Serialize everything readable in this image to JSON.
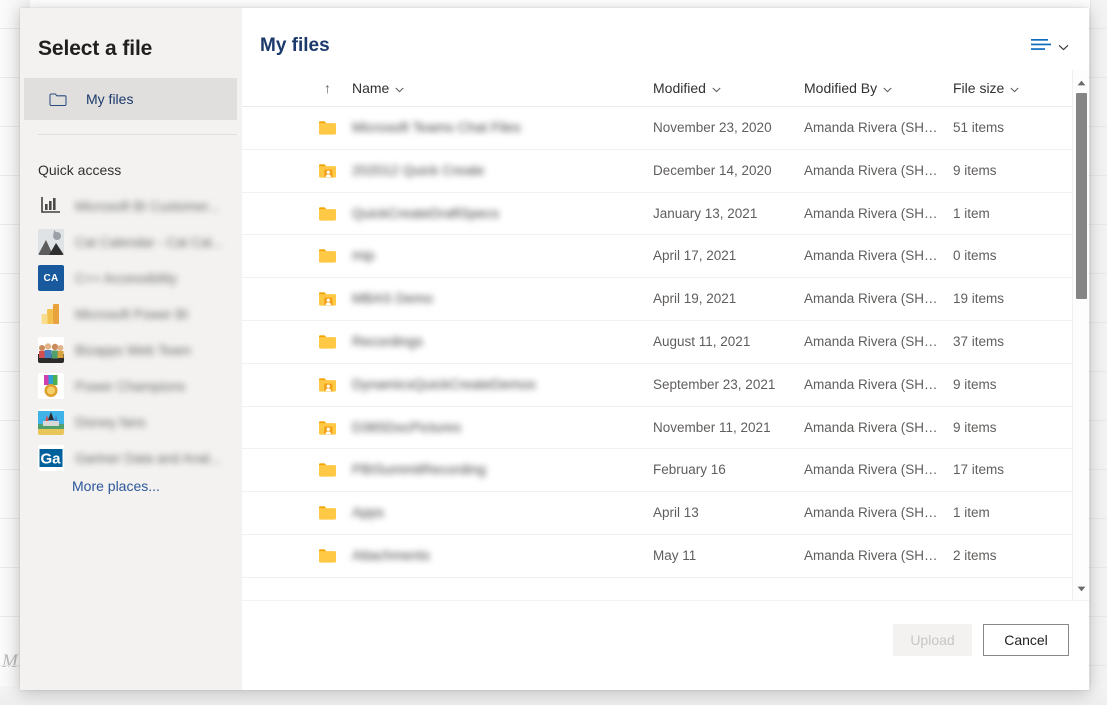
{
  "dialog": {
    "nav_title": "Select a file",
    "my_files_label": "My files",
    "my_files_icon": "folder-outline-icon",
    "quick_access_label": "Quick access",
    "more_places_label": "More places...",
    "quick_access_items": [
      {
        "label": "Microsoft BI Customer...",
        "icon": "power-bi-report-icon"
      },
      {
        "label": "Cat Calendar - Cat Cal...",
        "icon": "cat-photo-icon"
      },
      {
        "label": "C++ Accessibility",
        "icon": "ca-initials-icon",
        "initials": "CA",
        "color": "#185a9d"
      },
      {
        "label": "Microsoft Power BI",
        "icon": "power-bi-icon"
      },
      {
        "label": "Bizapps Web Team",
        "icon": "team-people-icon"
      },
      {
        "label": "Power Champions",
        "icon": "medal-icon"
      },
      {
        "label": "Disney fans",
        "icon": "castle-photo-icon"
      },
      {
        "label": "Gartner Data and Anal...",
        "icon": "gartner-logo-icon"
      }
    ]
  },
  "panel": {
    "title": "My files",
    "view_switcher_icon": "list-view-icon",
    "view_switcher_chevron": "chevron-down-icon"
  },
  "table": {
    "sort_indicator": "↑",
    "columns": [
      {
        "key": "name",
        "label": "Name",
        "chevron": "chevron-down-icon"
      },
      {
        "key": "modified",
        "label": "Modified",
        "chevron": "chevron-down-icon"
      },
      {
        "key": "modified_by",
        "label": "Modified By",
        "chevron": "chevron-down-icon"
      },
      {
        "key": "file_size",
        "label": "File size",
        "chevron": "chevron-down-icon"
      }
    ],
    "rows": [
      {
        "name": "Microsoft Teams Chat Files",
        "icon": "folder-icon",
        "modified": "November 23, 2020",
        "modified_by": "Amanda Rivera (SHE/H...",
        "file_size": "51 items"
      },
      {
        "name": "202012 Quick Create",
        "icon": "folder-shared-icon",
        "modified": "December 14, 2020",
        "modified_by": "Amanda Rivera (SHE/H...",
        "file_size": "9 items"
      },
      {
        "name": "QuickCreateDraftSpecs",
        "icon": "folder-icon",
        "modified": "January 13, 2021",
        "modified_by": "Amanda Rivera (SHE/H...",
        "file_size": "1 item"
      },
      {
        "name": "mip",
        "icon": "folder-icon",
        "modified": "April 17, 2021",
        "modified_by": "Amanda Rivera (SHE/H...",
        "file_size": "0 items"
      },
      {
        "name": "MBAS Demo",
        "icon": "folder-shared-icon",
        "modified": "April 19, 2021",
        "modified_by": "Amanda Rivera (SHE/H...",
        "file_size": "19 items"
      },
      {
        "name": "Recordings",
        "icon": "folder-icon",
        "modified": "August 11, 2021",
        "modified_by": "Amanda Rivera (SHE/H...",
        "file_size": "37 items"
      },
      {
        "name": "DynamicsQuickCreateDemos",
        "icon": "folder-shared-icon",
        "modified": "September 23, 2021",
        "modified_by": "Amanda Rivera (SHE/H...",
        "file_size": "9 items"
      },
      {
        "name": "D365DocPictures",
        "icon": "folder-shared-icon",
        "modified": "November 11, 2021",
        "modified_by": "Amanda Rivera (SHE/H...",
        "file_size": "9 items"
      },
      {
        "name": "PBISummitRecording",
        "icon": "folder-icon",
        "modified": "February 16",
        "modified_by": "Amanda Rivera (SHE/H...",
        "file_size": "17 items"
      },
      {
        "name": "Apps",
        "icon": "folder-icon",
        "modified": "April 13",
        "modified_by": "Amanda Rivera (SHE/H...",
        "file_size": "1 item"
      },
      {
        "name": "Attachments",
        "icon": "folder-icon",
        "modified": "May 11",
        "modified_by": "Amanda Rivera (SHE/H...",
        "file_size": "2 items"
      }
    ]
  },
  "footer": {
    "upload_label": "Upload",
    "upload_disabled": true,
    "cancel_label": "Cancel"
  },
  "background": {
    "letter": "M"
  },
  "colors": {
    "accent_blue": "#0078d4",
    "title_blue": "#1b3a6b",
    "link_blue": "#2b579a",
    "dialog_bg": "#f3f2f1",
    "selected_bg": "#e1dfdd",
    "folder_yellow": "#ffc845",
    "scrollbar_thumb": "#858585"
  }
}
